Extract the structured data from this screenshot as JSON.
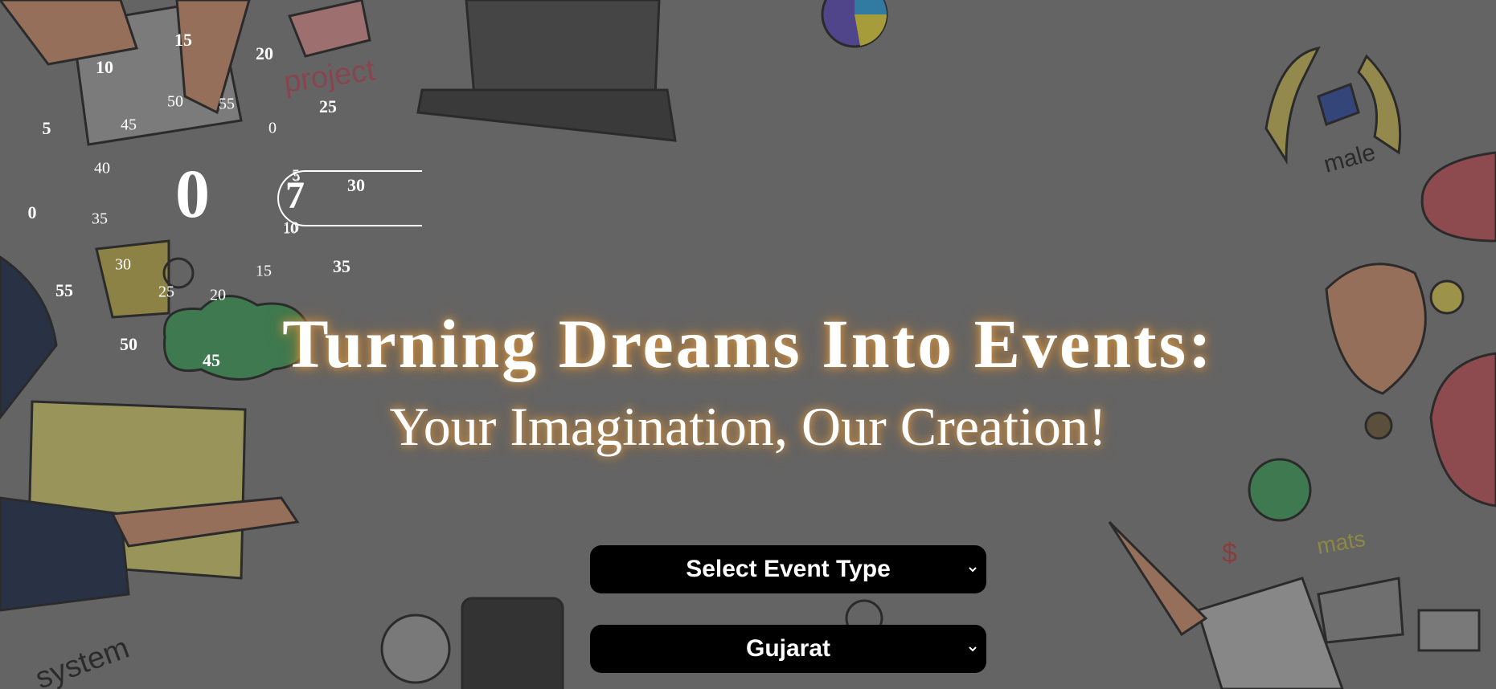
{
  "hero": {
    "title": "Turning Dreams Into Events:",
    "subtitle": "Your Imagination, Our Creation!"
  },
  "clock": {
    "hour_digit": "0",
    "seconds_digit": "7",
    "outer_ring": [
      "15",
      "20",
      "25",
      "30",
      "35",
      "45",
      "50",
      "55",
      "0",
      "5",
      "10"
    ],
    "middle_ring": [
      "50",
      "55",
      "0",
      "5",
      "10",
      "15",
      "20",
      "25",
      "30",
      "35",
      "40",
      "45"
    ],
    "inner_ring": [
      "5",
      "10"
    ]
  },
  "form": {
    "event_type": {
      "selected": "Select Event Type"
    },
    "state": {
      "selected": "Gujarat"
    }
  },
  "colors": {
    "glow": "#d49a4e",
    "select_bg": "#000000",
    "text": "#ffffff"
  },
  "icons": [
    "chevron-down-icon"
  ]
}
